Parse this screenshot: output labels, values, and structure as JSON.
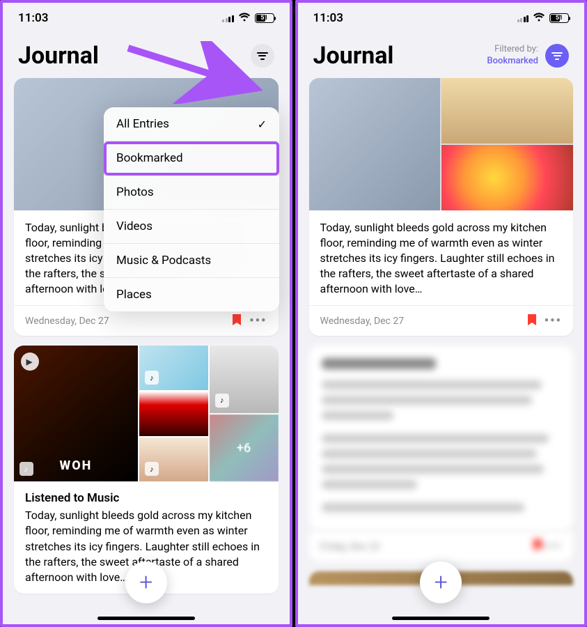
{
  "status": {
    "time": "11:03",
    "battery": "51"
  },
  "left": {
    "title": "Journal",
    "dropdown": [
      {
        "label": "All Entries",
        "checked": true
      },
      {
        "label": "Bookmarked",
        "checked": false,
        "highlight": true
      },
      {
        "label": "Photos",
        "checked": false
      },
      {
        "label": "Videos",
        "checked": false
      },
      {
        "label": "Music & Podcasts",
        "checked": false
      },
      {
        "label": "Places",
        "checked": false
      }
    ],
    "entry1": {
      "text": "Today, sunlight bleeds gold across my kitchen floor, reminding me of warmth even as winter stretches its icy fingers. Laughter still echoes in the rafters, the sweet aftertaste of a shared afternoon with love…",
      "date": "Wednesday, Dec 27"
    },
    "entry2": {
      "title": "Listened to Music",
      "text": "Today, sunlight bleeds gold across my kitchen floor, reminding me of warmth even as winter stretches its icy fingers. Laughter still echoes in the rafters, the sweet aftertaste of a shared afternoon with love…",
      "overflow": "+6",
      "album": "WOH"
    }
  },
  "right": {
    "title": "Journal",
    "filtered_label": "Filtered by:",
    "filtered_value": "Bookmarked",
    "entry1": {
      "text": "Today, sunlight bleeds gold across my kitchen floor, reminding me of warmth even as winter stretches its icy fingers. Laughter still echoes in the rafters, the sweet aftertaste of a shared afternoon with love…",
      "date": "Wednesday, Dec 27"
    },
    "entry_blur_date": "Friday, Dec 22"
  },
  "fab": "+"
}
